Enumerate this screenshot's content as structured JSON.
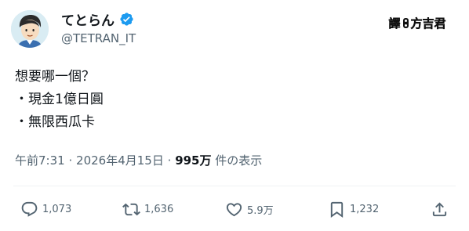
{
  "author": {
    "display_name": "てとらん",
    "handle": "@TETRAN_IT",
    "verified": true,
    "verified_color": "#1d9bf0",
    "avatar_icon": "cartoon-man-avatar"
  },
  "translator_badge": {
    "first_char": "譯",
    "name": "方吉君"
  },
  "tweet": {
    "lines": [
      "想要哪一個？",
      "・現金1億日圓",
      "・無限西瓜卡"
    ]
  },
  "meta": {
    "time": "午前7:31",
    "separator": "·",
    "date": "2026年4月15日",
    "views_count": "995万",
    "views_label": "件の表示"
  },
  "actions": {
    "reply": {
      "icon": "reply-icon",
      "count": "1,073"
    },
    "repost": {
      "icon": "repost-icon",
      "count": "1,636"
    },
    "like": {
      "icon": "like-icon",
      "count": "5.9万"
    },
    "bookmark": {
      "icon": "bookmark-icon",
      "count": "1,232"
    },
    "share": {
      "icon": "share-icon"
    }
  },
  "colors": {
    "text_primary": "#0f1419",
    "text_secondary": "#536471",
    "divider": "#eff3f4"
  }
}
